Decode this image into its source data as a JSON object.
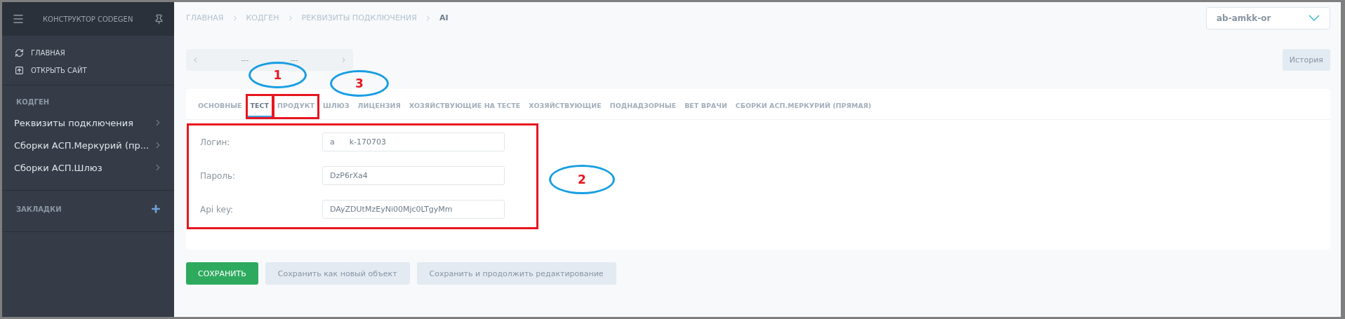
{
  "sidebar": {
    "title": "КОНСТРУКТОР CODEGEN",
    "nav": [
      {
        "label": "ГЛАВНАЯ",
        "kind": "home"
      },
      {
        "label": "ОТКРЫТЬ САЙТ",
        "kind": "site"
      }
    ],
    "sections": [
      {
        "title": "КОДГЕН",
        "kind": "links",
        "items": [
          "Реквизиты подключения",
          "Сборки АСП.Меркурий (пр...",
          "Сборки АСП.Шлюз"
        ]
      },
      {
        "title": "ЗАКЛАДКИ",
        "kind": "bookmarks"
      }
    ]
  },
  "breadcrumbs": [
    "ГЛАВНАЯ",
    "КОДГЕН",
    "РЕКВИЗИТЫ ПОДКЛЮЧЕНИЯ",
    "AI"
  ],
  "account_select": {
    "value": "ab-amkk-or"
  },
  "pager": {
    "left": "---",
    "right": "---"
  },
  "history_button": "История",
  "tabs": [
    {
      "label": "ОСНОВНЫЕ",
      "selected": false,
      "highlighted": false
    },
    {
      "label": "ТЕСТ",
      "selected": true,
      "highlighted": true
    },
    {
      "label": "ПРОДУКТ",
      "selected": false,
      "highlighted": true
    },
    {
      "label": "ШЛЮЗ",
      "selected": false,
      "highlighted": false
    },
    {
      "label": "ЛИЦЕНЗИЯ",
      "selected": false,
      "highlighted": false
    },
    {
      "label": "ХОЗЯЙСТВУЮЩИЕ НА ТЕСТЕ",
      "selected": false,
      "highlighted": false
    },
    {
      "label": "ХОЗЯЙСТВУЮЩИЕ",
      "selected": false,
      "highlighted": false
    },
    {
      "label": "ПОДНАДЗОРНЫЕ",
      "selected": false,
      "highlighted": false
    },
    {
      "label": "ВЕТ ВРАЧИ",
      "selected": false,
      "highlighted": false
    },
    {
      "label": "СБОРКИ АСП.МЕРКУРИЙ (ПРЯМАЯ)",
      "selected": false,
      "highlighted": false
    }
  ],
  "form": {
    "highlighted": true,
    "fields": [
      {
        "label": "Логин:",
        "value": "a      k-170703"
      },
      {
        "label": "Пароль:",
        "value": "DzP6rXa4"
      },
      {
        "label": "Api key:",
        "value": "DAyZDUtMzEyNi00Mjc0LTgyMm"
      }
    ]
  },
  "buttons": [
    {
      "label": "СОХРАНИТЬ",
      "kind": "primary"
    },
    {
      "label": "Сохранить как новый объект",
      "kind": "secondary"
    },
    {
      "label": "Сохранить и продолжить редактирование",
      "kind": "secondary"
    }
  ],
  "callouts": [
    "1",
    "3",
    "2"
  ]
}
